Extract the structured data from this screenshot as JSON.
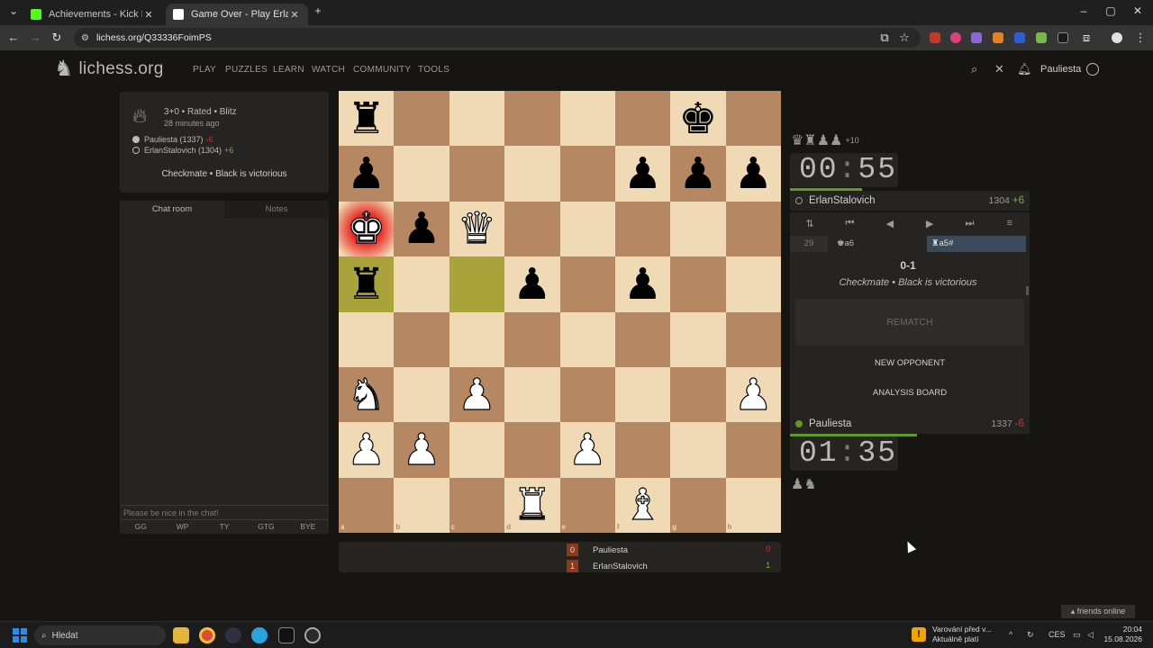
{
  "browser": {
    "tabs": [
      {
        "title": "Achievements - Kick Dashboard",
        "active": false,
        "favicon_color": "#53fc18"
      },
      {
        "title": "Game Over - Play ErlanStalovich",
        "active": true,
        "favicon_color": "#ffffff"
      }
    ],
    "new_tab_icon": "plus-icon",
    "url": "lichess.org/Q33336FoimPS",
    "site_info_icon": "tune-icon"
  },
  "header": {
    "logo_text": "lichess.org",
    "nav": [
      "PLAY",
      "PUZZLES",
      "LEARN",
      "WATCH",
      "COMMUNITY",
      "TOOLS"
    ],
    "username": "Pauliesta"
  },
  "game_info": {
    "setup": "3+0 • Rated • Blitz",
    "time_ago": "28 minutes ago",
    "white": {
      "name": "Pauliesta (1337)",
      "diff": "-6",
      "color": "#bababa"
    },
    "black": {
      "name": "ErlanStalovich (1304)",
      "diff": "+6",
      "color": "#161512"
    },
    "status": "Checkmate • Black is victorious"
  },
  "chat": {
    "tabs": [
      "Chat room",
      "Notes"
    ],
    "placeholder": "Please be nice in the chat!",
    "presets": [
      "GG",
      "WP",
      "TY",
      "GTG",
      "BYE"
    ]
  },
  "board": {
    "files": [
      "a",
      "b",
      "c",
      "d",
      "e",
      "f",
      "g",
      "h"
    ],
    "ranks": [
      "8",
      "7",
      "6",
      "5",
      "4",
      "3",
      "2",
      "1"
    ],
    "pieces": [
      {
        "sq": "a8",
        "p": "♜",
        "c": "b"
      },
      {
        "sq": "g8",
        "p": "♚",
        "c": "b"
      },
      {
        "sq": "a7",
        "p": "♟",
        "c": "b"
      },
      {
        "sq": "f7",
        "p": "♟",
        "c": "b"
      },
      {
        "sq": "g7",
        "p": "♟",
        "c": "b"
      },
      {
        "sq": "h7",
        "p": "♟",
        "c": "b"
      },
      {
        "sq": "a6",
        "p": "♚",
        "c": "w"
      },
      {
        "sq": "b6",
        "p": "♟",
        "c": "b"
      },
      {
        "sq": "c6",
        "p": "♛",
        "c": "w"
      },
      {
        "sq": "a5",
        "p": "♜",
        "c": "b"
      },
      {
        "sq": "d5",
        "p": "♟",
        "c": "b"
      },
      {
        "sq": "f5",
        "p": "♟",
        "c": "b"
      },
      {
        "sq": "a3",
        "p": "♞",
        "c": "w"
      },
      {
        "sq": "c3",
        "p": "♟",
        "c": "w"
      },
      {
        "sq": "h3",
        "p": "♟",
        "c": "w"
      },
      {
        "sq": "a2",
        "p": "♟",
        "c": "w"
      },
      {
        "sq": "b2",
        "p": "♟",
        "c": "w"
      },
      {
        "sq": "e2",
        "p": "♟",
        "c": "w"
      },
      {
        "sq": "d1",
        "p": "♜",
        "c": "w"
      },
      {
        "sq": "f1",
        "p": "♝",
        "c": "w"
      }
    ],
    "check_square": "a6",
    "last_move_squares": [
      "a5",
      "c5"
    ]
  },
  "opponent": {
    "name": "ErlanStalovich",
    "rating": "1304",
    "rating_diff": "+6",
    "clock_min": "00",
    "clock_sec": "55",
    "clock_fraction": 0.3,
    "material": "♛♜♟♟",
    "material_adv": "+10"
  },
  "me": {
    "name": "Pauliesta",
    "rating": "1337",
    "rating_diff": "-6",
    "clock_min": "01",
    "clock_sec": "35",
    "clock_fraction": 0.53,
    "material": "♟♞"
  },
  "moves": {
    "controls": [
      "⇅",
      "⏮",
      "◀",
      "▶",
      "⏭",
      "≡"
    ],
    "move_number": "29",
    "white_move": "♚a6",
    "black_move": "♜a5#",
    "result": "0-1",
    "result_text": "Checkmate • Black is victorious",
    "rematch": "REMATCH",
    "new_opponent": "NEW OPPONENT",
    "analysis": "ANALYSIS BOARD"
  },
  "scoreboard": {
    "rows": [
      {
        "num": "0",
        "name": "Pauliesta",
        "total": "0",
        "tot_color": "#cc3333"
      },
      {
        "num": "1",
        "name": "ErlanStalovich",
        "total": "1",
        "tot_color": "#7fa650"
      }
    ]
  },
  "friends": "friends online",
  "taskbar": {
    "search": "Hledat",
    "warning_line1": "Varování před v...",
    "warning_line2": "Aktuálně platí",
    "lang": "CES",
    "time": "20:04",
    "date": "15.08.2026"
  }
}
